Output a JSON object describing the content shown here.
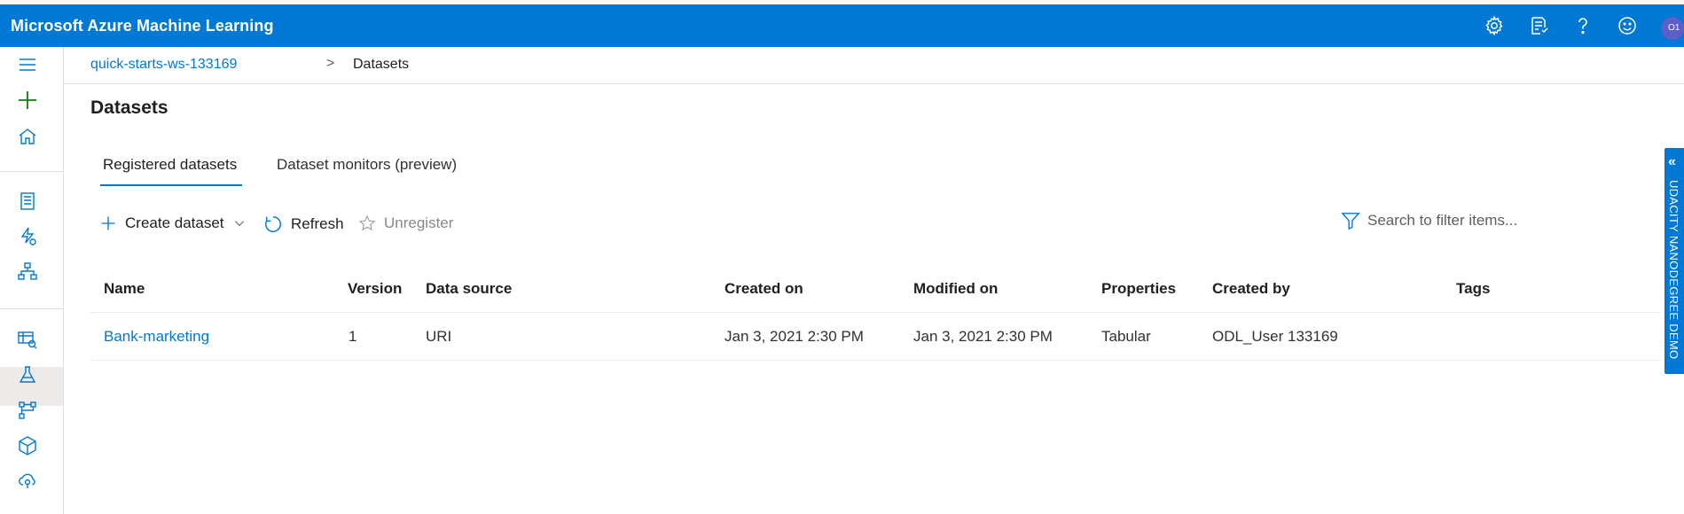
{
  "header": {
    "app_title": "Microsoft Azure Machine Learning",
    "avatar_initials": "O1",
    "icons": [
      "gear-icon",
      "feedback-icon",
      "help-icon",
      "smiley-icon"
    ]
  },
  "left_nav": {
    "items": [
      "menu-icon",
      "plus-icon",
      "home-icon",
      "notebook-icon",
      "automl-icon",
      "designer-icon",
      "datasets-icon",
      "experiments-icon",
      "pipelines-icon",
      "models-icon",
      "endpoints-icon"
    ],
    "selected": "datasets-icon"
  },
  "breadcrumb": {
    "workspace": "quick-starts-ws-133169",
    "separator": ">",
    "current": "Datasets"
  },
  "page": {
    "title": "Datasets"
  },
  "tabs": [
    {
      "label": "Registered datasets",
      "active": true
    },
    {
      "label": "Dataset monitors (preview)",
      "active": false
    }
  ],
  "toolbar": {
    "create_label": "Create dataset",
    "refresh_label": "Refresh",
    "unregister_label": "Unregister",
    "search_placeholder": "Search to filter items..."
  },
  "table": {
    "columns": [
      "Name",
      "Version",
      "Data source",
      "Created on",
      "Modified on",
      "Properties",
      "Created by",
      "Tags"
    ],
    "rows": [
      {
        "name": "Bank-marketing",
        "version": "1",
        "data_source": "URI",
        "created_on": "Jan 3, 2021 2:30 PM",
        "modified_on": "Jan 3, 2021 2:30 PM",
        "properties": "Tabular",
        "created_by": "ODL_User 133169",
        "tags": ""
      }
    ]
  },
  "side_panel": {
    "label": "UDACITY NANODEGREE DEMO",
    "chevron": "«"
  },
  "colors": {
    "brand": "#0078d4",
    "add_icon": "#107c10"
  }
}
